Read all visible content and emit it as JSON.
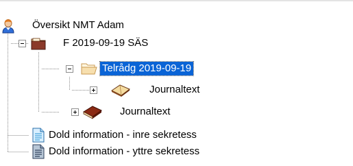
{
  "tree": {
    "root": {
      "label": "Översikt NMT Adam",
      "icon": "user-icon"
    },
    "f_node": {
      "label": "F 2019-09-19  SÄS",
      "icon": "folder-icon",
      "expanded": true
    },
    "telradg_node": {
      "label": "Telrådg 2019-09-19",
      "icon": "folder-open-icon",
      "expanded": true,
      "selected": true
    },
    "journaltext_inner": {
      "label": "Journaltext",
      "icon": "open-book-icon",
      "expanded": false
    },
    "journaltext_outer": {
      "label": "Journaltext",
      "icon": "book-icon",
      "expanded": false
    },
    "dold_inre": {
      "label": "Dold information - inre sekretess",
      "icon": "document-icon"
    },
    "dold_yttre": {
      "label": "Dold information - yttre sekretess",
      "icon": "document-dark-icon"
    }
  },
  "colors": {
    "selection": "#0a64d6",
    "folder_red": "#8b3a2a",
    "folder_beige": "#f2d6a2",
    "book_brown": "#7a2a14",
    "doc_blue": "#3fa0d8"
  }
}
